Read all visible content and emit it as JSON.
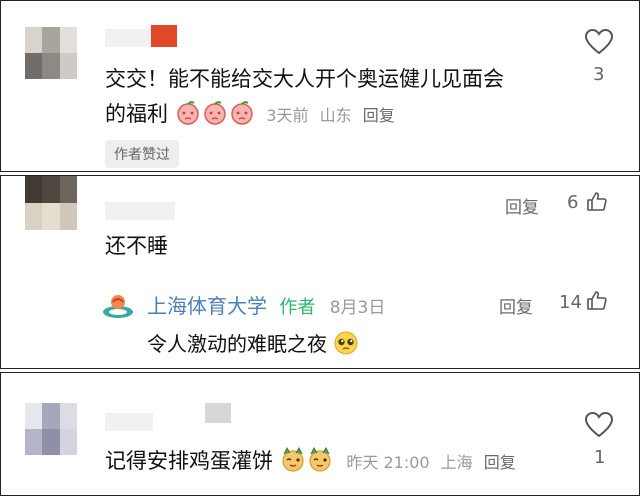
{
  "comments": [
    {
      "text_line1": "交交！能不能给交大人开个奥运健儿见面会",
      "text_line2": "的福利",
      "emojis": [
        "peach-sad-emoji",
        "peach-sad-emoji",
        "peach-sad-emoji"
      ],
      "time": "3天前",
      "location": "山东",
      "reply_label": "回复",
      "like_count": "3",
      "author_liked": "作者赞过"
    },
    {
      "text": "还不睡",
      "reply_label": "回复",
      "like_count": "6",
      "sub_reply": {
        "name": "上海体育大学",
        "author_tag": "作者",
        "date": "8月3日",
        "reply_label": "回复",
        "like_count": "14",
        "text": "令人激动的难眠之夜",
        "emoji": "pleading-face-emoji"
      }
    },
    {
      "text": "记得安排鸡蛋灌饼",
      "emojis": [
        "dog-wink-emoji",
        "dog-wink-emoji"
      ],
      "time": "昨天 21:00",
      "location": "上海",
      "reply_label": "回复",
      "like_count": "1"
    }
  ],
  "colors": {
    "author_green": "#2fb56a",
    "name_blue": "#4d7fb8",
    "meta_gray": "#9a9a9a",
    "heart_gray": "#555555",
    "badge_bg": "#eeeeee"
  },
  "icons": {
    "like_heart": "heart-outline-icon",
    "thumbs_up": "thumbs-up-icon"
  }
}
